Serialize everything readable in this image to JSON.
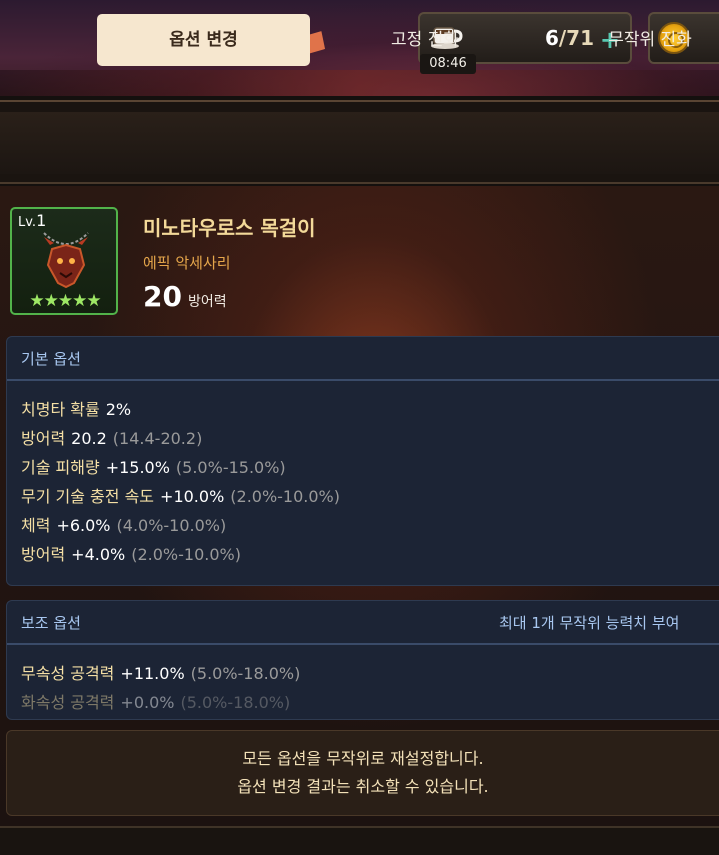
{
  "header": {
    "stamina_current": "6",
    "stamina_max": "/71",
    "timer": "08:46"
  },
  "tabs": [
    {
      "label": "옵션 변경",
      "active": true
    },
    {
      "label": "고정 진화",
      "active": false
    },
    {
      "label": "무작위 진화",
      "active": false
    }
  ],
  "item": {
    "level_prefix": "Lv.",
    "level": "1",
    "stars": "★★★★★",
    "name": "미노타우로스 목걸이",
    "grade": "에픽 악세사리",
    "stat_value": "20",
    "stat_label": "방어력"
  },
  "basic_options": {
    "title": "기본 옵션",
    "items": [
      {
        "name": "치명타 확률",
        "value": "2%",
        "range": ""
      },
      {
        "name": "방어력",
        "value": "20.2",
        "range": "(14.4-20.2)"
      },
      {
        "name": "기술 피해량",
        "value": "+15.0%",
        "range": "(5.0%-15.0%)"
      },
      {
        "name": "무기 기술 충전 속도",
        "value": "+10.0%",
        "range": "(2.0%-10.0%)"
      },
      {
        "name": "체력",
        "value": "+6.0%",
        "range": "(4.0%-10.0%)"
      },
      {
        "name": "방어력",
        "value": "+4.0%",
        "range": "(2.0%-10.0%)"
      }
    ]
  },
  "sub_options": {
    "title": "보조 옵션",
    "note": "최대 1개 무작위 능력치 부여",
    "items": [
      {
        "name": "무속성 공격력",
        "value": "+11.0%",
        "range": "(5.0%-18.0%)"
      },
      {
        "name": "화속성 공격력",
        "value": "+0.0%",
        "range": "(5.0%-18.0%)"
      }
    ]
  },
  "info": {
    "line1": "모든 옵션을 무작위로 재설정합니다.",
    "line2": "옵션 변경 결과는 취소할 수 있습니다."
  },
  "colors": {
    "active_tab": "#f6e7cf",
    "option_name": "#f4dfa5",
    "panel_bg": "#1c2435",
    "epic_grade": "#e5a64b",
    "star_green": "#9ee865"
  }
}
